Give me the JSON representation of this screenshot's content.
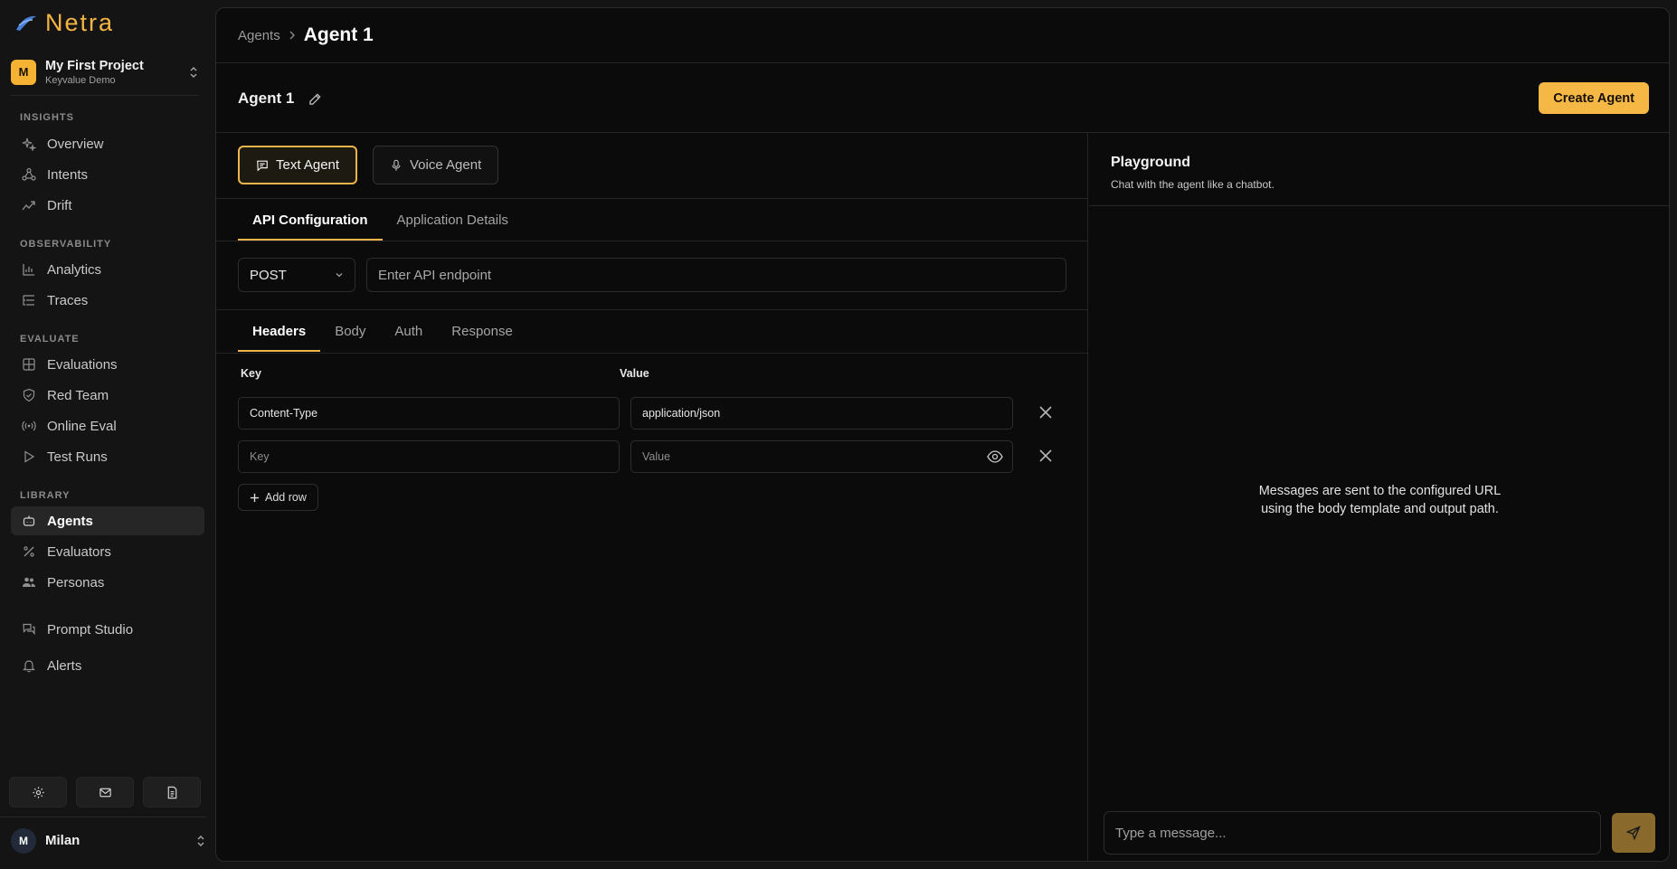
{
  "brand": {
    "name": "Netra",
    "accent": "#f5b845"
  },
  "project": {
    "avatar": "M",
    "name": "My First Project",
    "subtitle": "Keyvalue Demo"
  },
  "sidebar": {
    "sections": {
      "insights": "INSIGHTS",
      "observability": "OBSERVABILITY",
      "evaluate": "EVALUATE",
      "library": "LIBRARY"
    },
    "items": {
      "overview": "Overview",
      "intents": "Intents",
      "drift": "Drift",
      "analytics": "Analytics",
      "traces": "Traces",
      "evaluations": "Evaluations",
      "red_team": "Red Team",
      "online_eval": "Online Eval",
      "test_runs": "Test Runs",
      "agents": "Agents",
      "evaluators": "Evaluators",
      "personas": "Personas",
      "prompt_studio": "Prompt Studio",
      "alerts": "Alerts"
    },
    "active": "agents",
    "footer_icons": [
      "gear-icon",
      "mail-icon",
      "document-icon"
    ],
    "user": {
      "avatar": "M",
      "name": "Milan"
    }
  },
  "breadcrumb": {
    "parent": "Agents",
    "current": "Agent 1"
  },
  "agent": {
    "name": "Agent 1",
    "create_label": "Create Agent"
  },
  "agent_type": {
    "text": "Text Agent",
    "voice": "Voice Agent",
    "selected": "text"
  },
  "config_tabs": {
    "api": "API Configuration",
    "app": "Application Details",
    "active": "api"
  },
  "request": {
    "method": "POST",
    "endpoint_placeholder": "Enter API endpoint"
  },
  "request_tabs": {
    "headers": "Headers",
    "body": "Body",
    "auth": "Auth",
    "response": "Response",
    "active": "headers"
  },
  "headers": {
    "key_label": "Key",
    "value_label": "Value",
    "rows": [
      {
        "key": "Content-Type",
        "value": "application/json"
      },
      {
        "key_placeholder": "Key",
        "value_placeholder": "Value"
      }
    ],
    "add_row": "Add row"
  },
  "playground": {
    "title": "Playground",
    "subtitle": "Chat with the agent like a chatbot.",
    "empty_line1": "Messages are sent to the configured URL",
    "empty_line2": "using the body template and output path.",
    "input_placeholder": "Type a message..."
  }
}
